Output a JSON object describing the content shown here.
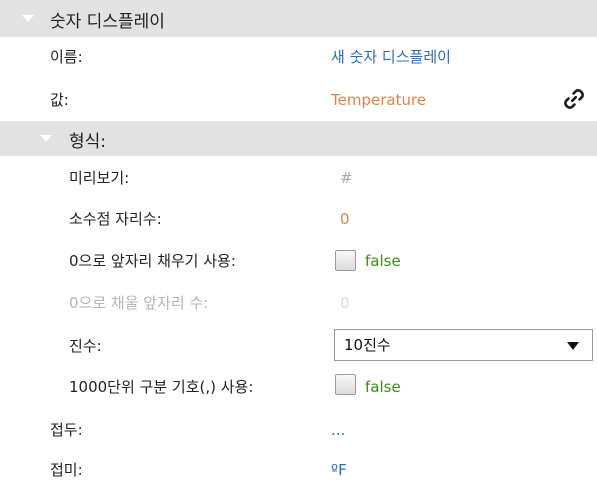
{
  "panel": {
    "title": "숫자 디스플레이"
  },
  "rows": {
    "name": {
      "label": "이름:",
      "value": "새 숫자 디스플레이"
    },
    "value": {
      "label": "값:",
      "value": "Temperature"
    }
  },
  "format": {
    "title": "형식:",
    "preview": {
      "label": "미리보기:",
      "value": "#"
    },
    "decimals": {
      "label": "소수점 자리수:",
      "value": "0"
    },
    "zero_pad": {
      "label": "0으로 앞자리 채우기 사용:",
      "value": "false"
    },
    "pad_digits": {
      "label": "0으로 채울 앞자리 수:",
      "value": "0"
    },
    "radix": {
      "label": "진수:",
      "selected": "10진수"
    },
    "thousands": {
      "label": "1000단위 구분 기호(,) 사용:",
      "value": "false"
    }
  },
  "prefix": {
    "label": "접두:",
    "value": "..."
  },
  "suffix": {
    "label": "접미:",
    "value": "ºF"
  },
  "colors": {
    "header_bg": "#e2e2e2",
    "link_blue": "#2a6cb4",
    "binding_orange": "#d9844c",
    "bool_green": "#3c8c1e"
  },
  "icons": {
    "binding": "link-icon",
    "expand": "triangle-down-icon",
    "dropdown": "chevron-down-icon"
  }
}
